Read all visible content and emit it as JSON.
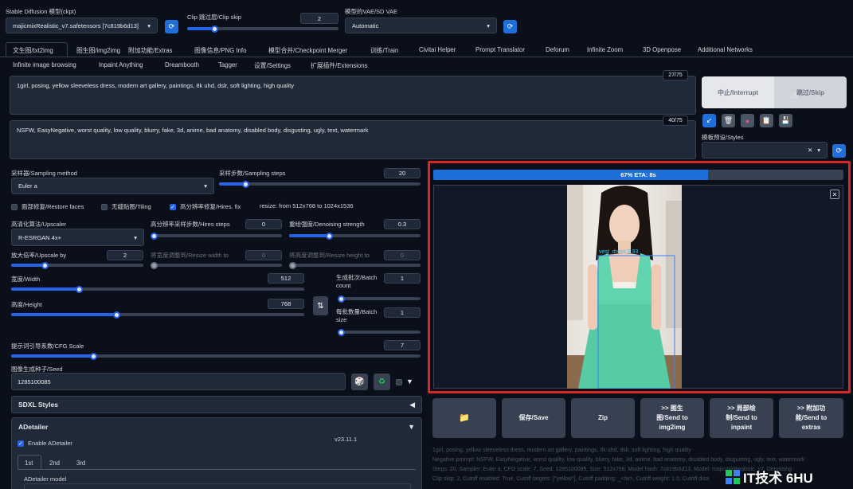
{
  "top": {
    "model_label": "Stable Diffusion 模型(ckpt)",
    "model_value": "majicmixRealistic_v7.safetensors [7c819b6d13]",
    "clip_label": "Clip 跳过层/Clip skip",
    "clip_value": "2",
    "clip_fraction": 0.18,
    "vae_label": "模型的VAE/SD VAE",
    "vae_value": "Automatic"
  },
  "tabs_row1": [
    "文生图/txt2img",
    "图生图/img2img",
    "附加功能/Extras",
    "图像信息/PNG Info",
    "模型合并/Checkpoint Merger",
    "训练/Train",
    "Civitai Helper",
    "Prompt Translator",
    "Deforum",
    "Infinite Zoom",
    "3D Openpose",
    "Additional Networks"
  ],
  "tabs_row2": [
    "Infinite image browsing",
    "Inpaint Anything",
    "Dreambooth",
    "Tagger",
    "设置/Settings",
    "扩展插件/Extensions"
  ],
  "prompt": {
    "positive": "1girl, posing, yellow sleeveless dress, modern art gallery, paintings, 8k uhd, dslr, soft lighting, high quality",
    "positive_count": "27/75",
    "negative": "NSFW, EasyNegative, worst quality, low quality, blurry, fake, 3d, anime, bad anatomy, disabled body, disgusting, ugly, text, watermark",
    "negative_count": "40/75"
  },
  "right_buttons": {
    "interrupt": "中止/Interrupt",
    "skip": "跳过/Skip",
    "styles_label": "模板预设/Styles"
  },
  "sampling": {
    "method_label": "采样器/Sampling method",
    "method_value": "Euler a",
    "steps_label": "采样步数/Sampling steps",
    "steps_value": "20",
    "steps_fraction": 0.13
  },
  "checks": {
    "restore_faces": "面部修复/Restore faces",
    "tiling": "无缝贴图/Tiling",
    "hires_fix": "高分辨率修复/Hires. fix",
    "resize_info": "resize: from 512x768 to 1024x1536"
  },
  "hires": {
    "upscaler_label": "高清化算法/Upscaler",
    "upscaler_value": "R-ESRGAN 4x+",
    "hires_steps_label": "高分辨率采样步数/Hires steps",
    "hires_steps_value": "0",
    "denoise_label": "重绘强度/Denoising strength",
    "denoise_value": "0.3",
    "denoise_fraction": 0.3,
    "upscale_by_label": "放大倍率/Upscale by",
    "upscale_by_value": "2",
    "upscale_by_fraction": 0.25,
    "resize_w_label": "将宽度调整到/Resize width to",
    "resize_w_value": "0",
    "resize_h_label": "将高度调整到/Resize height to",
    "resize_h_value": "0"
  },
  "size": {
    "width_label": "宽度/Width",
    "width_value": "512",
    "width_fraction": 0.23,
    "height_label": "高度/Height",
    "height_value": "768",
    "height_fraction": 0.36,
    "batch_count_label": "生成批次/Batch count",
    "batch_count_value": "1",
    "batch_size_label": "每批数量/Batch size",
    "batch_size_value": "1"
  },
  "cfg": {
    "label": "提示词引导系数/CFG Scale",
    "value": "7",
    "fraction": 0.2
  },
  "seed": {
    "label": "图像生成种子/Seed",
    "value": "1285100085"
  },
  "accordions": {
    "sdxl": "SDXL Styles",
    "adetailer": "ADetailer",
    "enable_adetailer": "Enable ADetailer",
    "version": "v23.11.1",
    "tabs": [
      "1st",
      "2nd",
      "3rd"
    ],
    "model_label": "ADetailer model"
  },
  "output": {
    "progress_text": "67% ETA: 8s",
    "progress_fraction": 0.67,
    "detection_label": "vest_dress 0.93",
    "buttons": [
      "保存/Save",
      "Zip",
      ">> 图生图/Send to img2img",
      ">> 局部绘制/Send to inpaint",
      ">> 附加功能/Send to extras"
    ],
    "info_lines": [
      "1girl, posing, yellow sleeveless dress, modern art gallery, paintings, 8k uhd, dslr, soft lighting, high quality",
      "Negative prompt: NSFW, EasyNegative, worst quality, low quality, blurry, fake, 3d, anime, bad anatomy, disabled body, disgusting, ugly, text, watermark",
      "Steps: 20, Sampler: Euler a, CFG scale: 7, Seed: 1285100085, Size: 512x768, Model hash: 7c819b6d13, Model: majicmixRealistic_v7, Denoising",
      "Clip skip: 2, Cutoff enabled: True, Cutoff targets: [\"yellow\"], Cutoff padding: _</w>, Cutoff weight: 1.0, Cutoff disa"
    ]
  },
  "watermark": "IT技术 6HU",
  "colors": {
    "accent": "#2563eb",
    "highlight": "#dc2626",
    "dress": "#5fd4ae"
  }
}
